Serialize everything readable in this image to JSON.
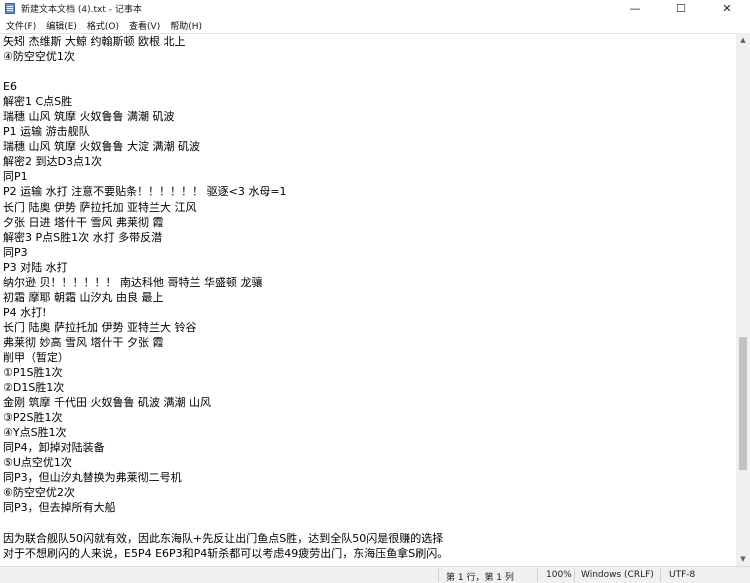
{
  "window": {
    "title": "新建文本文档 (4).txt - 记事本",
    "controls": {
      "minimize": "—",
      "maximize": "☐",
      "close": "✕"
    }
  },
  "menu": [
    "文件(F)",
    "编辑(E)",
    "格式(O)",
    "查看(V)",
    "帮助(H)"
  ],
  "editor": {
    "lines": [
      "矢矧 杰维斯 大鲸 约翰斯顿 欧根 北上",
      "④防空空优1次",
      "",
      "E6",
      "解密1 C点S胜",
      "瑞穗 山风 筑摩 火奴鲁鲁 满潮 矶波",
      "P1 运输 游击舰队",
      "瑞穗 山风 筑摩 火奴鲁鲁 大淀 满潮 矶波",
      "解密2 到达D3点1次",
      "同P1",
      "P2 运输 水打 注意不要贴条！！！！！！ 驱逐<3 水母=1",
      "长门 陆奥 伊势 萨拉托加 亚特兰大 江风",
      "夕张 日进 塔什干 雪风 弗莱彻 霞",
      "解密3 P点S胜1次 水打 多带反潜",
      "同P3",
      "P3 对陆 水打",
      "纳尔逊 贝！！！！！！ 南达科他 哥特兰 华盛顿 龙骧",
      "初霜 摩耶 朝霜 山汐丸 由良 最上",
      "P4 水打!",
      "长门 陆奥 萨拉托加 伊势 亚特兰大 铃谷",
      "弗莱彻 妙高 雪风 塔什干 夕张 霞",
      "削甲（暂定）",
      "①P1S胜1次",
      "②D1S胜1次",
      "金刚 筑摩 千代田 火奴鲁鲁 矶波 满潮 山风",
      "③P2S胜1次",
      "④Y点S胜1次",
      "同P4，卸掉对陆装备",
      "⑤U点空优1次",
      "同P3，但山汐丸替换为弗莱彻二号机",
      "⑥防空空优2次",
      "同P3，但去掉所有大船",
      "",
      "因为联合舰队50闪就有效，因此东海队+先反让出门鱼点S胜，达到全队50闪是很赚的选择",
      "对于不想刷闪的人来说，E5P4 E6P3和P4斩杀都可以考虑49疲劳出门，东海压鱼拿S刷闪。"
    ]
  },
  "scrollbar": {
    "up_arrow": "▲",
    "down_arrow": "▼",
    "position_fraction": 0.78
  },
  "status": {
    "position": "第 1 行，第 1 列",
    "zoom": "100%",
    "line_ending": "Windows (CRLF)",
    "encoding": "UTF-8"
  }
}
